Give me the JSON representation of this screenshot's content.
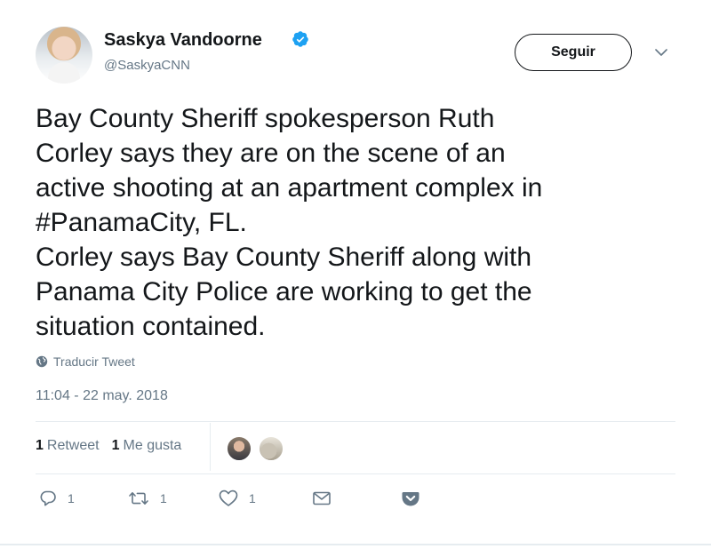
{
  "author": {
    "name": "Saskya Vandoorne",
    "handle": "@SaskyaCNN",
    "verified": true
  },
  "follow_button": {
    "label": "Seguir"
  },
  "tweet": {
    "lines": [
      "Bay County Sheriff spokesperson Ruth",
      "Corley says they are on the scene of an",
      "active shooting at an apartment complex in",
      "#PanamaCity, FL.",
      "Corley says Bay County Sheriff along with",
      "Panama City Police are working to get the",
      "situation contained."
    ],
    "hashtag": "#PanamaCity"
  },
  "translate_label": "Traducir Tweet",
  "timestamp": "11:04 - 22 may. 2018",
  "stats": {
    "retweets_count": "1",
    "retweets_label": "Retweet",
    "likes_count": "1",
    "likes_label": "Me gusta"
  },
  "actions": {
    "reply_count": "1",
    "retweet_count": "1",
    "like_count": "1"
  },
  "colors": {
    "verified": "#1da1f2",
    "secondary_text": "#657786",
    "divider": "#e6ecf0"
  },
  "icons": [
    "verified-badge-icon",
    "chevron-down-icon",
    "globe-icon",
    "reply-icon",
    "retweet-icon",
    "heart-icon",
    "envelope-icon",
    "pocket-icon"
  ]
}
